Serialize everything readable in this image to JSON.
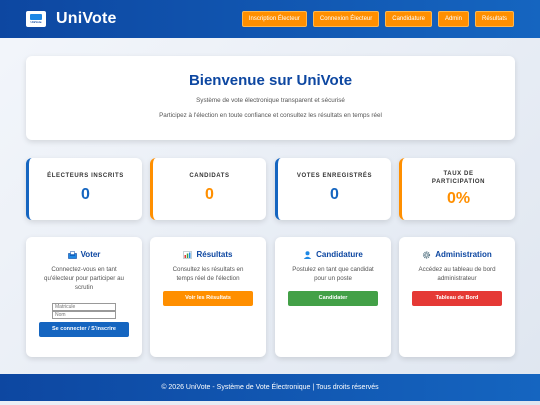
{
  "header": {
    "logo_text": "UniVote",
    "brand": "UniVote",
    "nav": [
      "Inscription Électeur",
      "Connexion Électeur",
      "Candidature",
      "Admin",
      "Résultats"
    ]
  },
  "welcome": {
    "title": "Bienvenue sur UniVote",
    "subtitle": "Système de vote électronique transparent et sécurisé",
    "lead": "Participez à l'élection en toute confiance et consultez les résultats en temps réel"
  },
  "stats": [
    {
      "label": "ÉLECTEURS INSCRITS",
      "value": "0"
    },
    {
      "label": "CANDIDATS",
      "value": "0"
    },
    {
      "label": "VOTES ENREGISTRÉS",
      "value": "0"
    },
    {
      "label": "TAUX DE PARTICIPATION",
      "value": "0%"
    }
  ],
  "features": {
    "voter": {
      "icon": "ballot-box-icon",
      "title": "Voter",
      "desc": "Connectez-vous en tant qu'électeur pour participer au scrutin",
      "matricule_placeholder": "Matricule",
      "nom_placeholder": "Nom",
      "button": "Se connecter / S'inscrire"
    },
    "resultats": {
      "icon": "bar-chart-icon",
      "title": "Résultats",
      "desc": "Consultez les résultats en temps réel de l'élection",
      "button": "Voir les Résultats"
    },
    "candidature": {
      "icon": "user-icon",
      "title": "Candidature",
      "desc": "Postulez en tant que candidat pour un poste",
      "button": "Candidater"
    },
    "administration": {
      "icon": "gear-icon",
      "title": "Administration",
      "desc": "Accédez au tableau de bord administrateur",
      "button": "Tableau de Bord"
    }
  },
  "footer": {
    "text": "© 2026 UniVote - Système de Vote Électronique | Tous droits réservés"
  },
  "colors": {
    "primary": "#0d47a1",
    "accent": "#ff8f00",
    "success": "#43a047",
    "danger": "#e53935"
  }
}
